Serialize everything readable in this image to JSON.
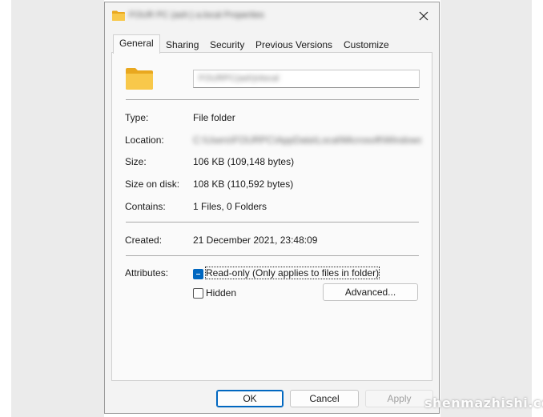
{
  "window": {
    "title": "FOUR PC (ash:) a.local Properties",
    "close_icon": "close-icon",
    "folder_icon": "folder-icon"
  },
  "tabs": [
    {
      "label": "General",
      "active": true
    },
    {
      "label": "Sharing",
      "active": false
    },
    {
      "label": "Security",
      "active": false
    },
    {
      "label": "Previous Versions",
      "active": false
    },
    {
      "label": "Customize",
      "active": false
    }
  ],
  "general": {
    "folder_name": "FOURPC(ash)nlocal",
    "properties": {
      "type_label": "Type:",
      "type_value": "File folder",
      "location_label": "Location:",
      "location_value": "C:\\Users\\FOURPC\\AppData\\Local\\Microsoft\\Windows\\Temp\\cache",
      "size_label": "Size:",
      "size_value": "106 KB (109,148 bytes)",
      "size_on_disk_label": "Size on disk:",
      "size_on_disk_value": "108 KB (110,592 bytes)",
      "contains_label": "Contains:",
      "contains_value": "1 Files, 0 Folders",
      "created_label": "Created:",
      "created_value": "21 December 2021, 23:48:09"
    },
    "attributes": {
      "label": "Attributes:",
      "readonly_label": "Read-only (Only applies to files in folder)",
      "readonly_state": "indeterminate",
      "hidden_label": "Hidden",
      "hidden_checked": false,
      "advanced_label": "Advanced..."
    }
  },
  "footer": {
    "ok_label": "OK",
    "cancel_label": "Cancel",
    "apply_label": "Apply"
  },
  "watermark": "shenmazhishi.com",
  "colors": {
    "accent": "#0067c0",
    "folder": "#f8c84a",
    "dialog_bg": "#f3f3f3"
  }
}
